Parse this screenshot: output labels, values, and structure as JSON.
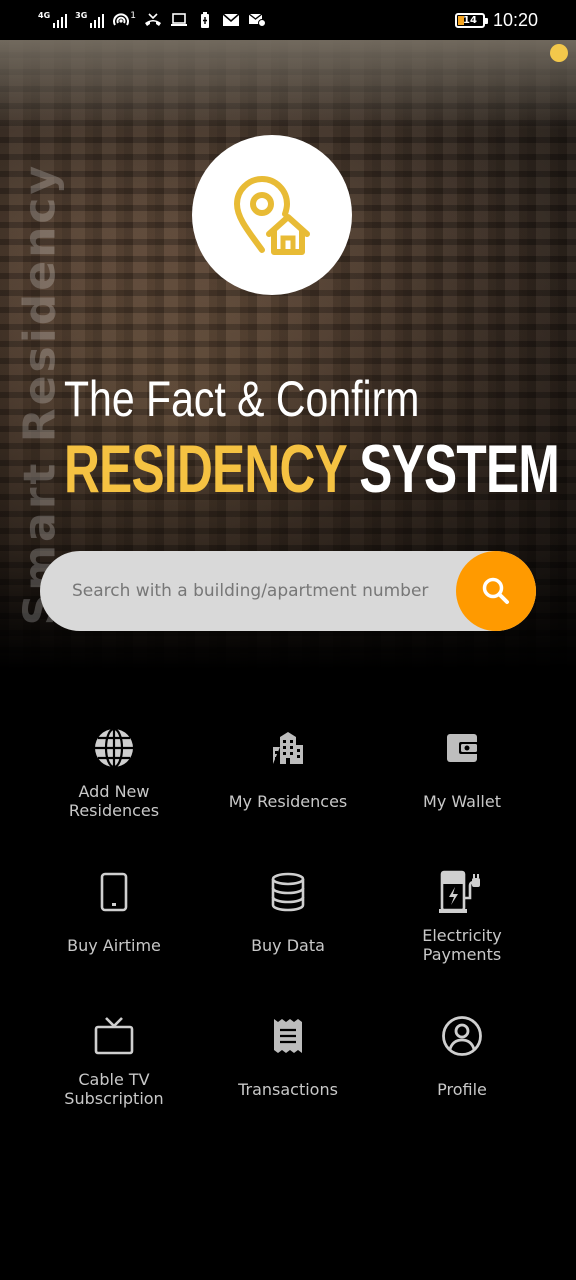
{
  "status_bar": {
    "network_1": "4G",
    "network_2": "3G",
    "hotspot_count": "1",
    "battery": "14",
    "time": "10:20"
  },
  "hero": {
    "watermark": "Smart Residency",
    "title_line1": "The Fact & Confirm",
    "title_accent": "RESIDENCY",
    "title_rest": "SYSTEM",
    "logo_icon": "location-home-icon",
    "accent_color": "#f5c242"
  },
  "search": {
    "placeholder": "Search with a building/apartment number",
    "value": "",
    "button_color": "#ff9a00"
  },
  "menu": [
    {
      "label": "Add New\nResidences",
      "icon": "globe-icon"
    },
    {
      "label": "My Residences",
      "icon": "building-icon"
    },
    {
      "label": "My Wallet",
      "icon": "wallet-icon"
    },
    {
      "label": "Buy Airtime",
      "icon": "phone-icon"
    },
    {
      "label": "Buy Data",
      "icon": "database-icon"
    },
    {
      "label": "Electricity\nPayments",
      "icon": "ev-charger-icon"
    },
    {
      "label": "Cable TV\nSubscription",
      "icon": "tv-icon"
    },
    {
      "label": "Transactions",
      "icon": "receipt-icon"
    },
    {
      "label": "Profile",
      "icon": "profile-icon"
    }
  ]
}
